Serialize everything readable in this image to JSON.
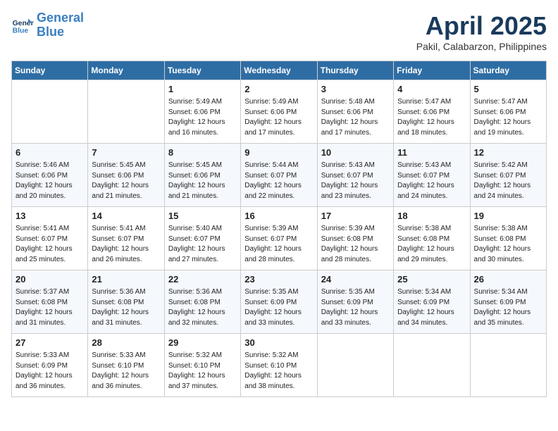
{
  "header": {
    "logo_line1": "General",
    "logo_line2": "Blue",
    "title": "April 2025",
    "location": "Pakil, Calabarzon, Philippines"
  },
  "weekdays": [
    "Sunday",
    "Monday",
    "Tuesday",
    "Wednesday",
    "Thursday",
    "Friday",
    "Saturday"
  ],
  "weeks": [
    [
      {
        "day": "",
        "sunrise": "",
        "sunset": "",
        "daylight": ""
      },
      {
        "day": "",
        "sunrise": "",
        "sunset": "",
        "daylight": ""
      },
      {
        "day": "1",
        "sunrise": "Sunrise: 5:49 AM",
        "sunset": "Sunset: 6:06 PM",
        "daylight": "Daylight: 12 hours and 16 minutes."
      },
      {
        "day": "2",
        "sunrise": "Sunrise: 5:49 AM",
        "sunset": "Sunset: 6:06 PM",
        "daylight": "Daylight: 12 hours and 17 minutes."
      },
      {
        "day": "3",
        "sunrise": "Sunrise: 5:48 AM",
        "sunset": "Sunset: 6:06 PM",
        "daylight": "Daylight: 12 hours and 17 minutes."
      },
      {
        "day": "4",
        "sunrise": "Sunrise: 5:47 AM",
        "sunset": "Sunset: 6:06 PM",
        "daylight": "Daylight: 12 hours and 18 minutes."
      },
      {
        "day": "5",
        "sunrise": "Sunrise: 5:47 AM",
        "sunset": "Sunset: 6:06 PM",
        "daylight": "Daylight: 12 hours and 19 minutes."
      }
    ],
    [
      {
        "day": "6",
        "sunrise": "Sunrise: 5:46 AM",
        "sunset": "Sunset: 6:06 PM",
        "daylight": "Daylight: 12 hours and 20 minutes."
      },
      {
        "day": "7",
        "sunrise": "Sunrise: 5:45 AM",
        "sunset": "Sunset: 6:06 PM",
        "daylight": "Daylight: 12 hours and 21 minutes."
      },
      {
        "day": "8",
        "sunrise": "Sunrise: 5:45 AM",
        "sunset": "Sunset: 6:06 PM",
        "daylight": "Daylight: 12 hours and 21 minutes."
      },
      {
        "day": "9",
        "sunrise": "Sunrise: 5:44 AM",
        "sunset": "Sunset: 6:07 PM",
        "daylight": "Daylight: 12 hours and 22 minutes."
      },
      {
        "day": "10",
        "sunrise": "Sunrise: 5:43 AM",
        "sunset": "Sunset: 6:07 PM",
        "daylight": "Daylight: 12 hours and 23 minutes."
      },
      {
        "day": "11",
        "sunrise": "Sunrise: 5:43 AM",
        "sunset": "Sunset: 6:07 PM",
        "daylight": "Daylight: 12 hours and 24 minutes."
      },
      {
        "day": "12",
        "sunrise": "Sunrise: 5:42 AM",
        "sunset": "Sunset: 6:07 PM",
        "daylight": "Daylight: 12 hours and 24 minutes."
      }
    ],
    [
      {
        "day": "13",
        "sunrise": "Sunrise: 5:41 AM",
        "sunset": "Sunset: 6:07 PM",
        "daylight": "Daylight: 12 hours and 25 minutes."
      },
      {
        "day": "14",
        "sunrise": "Sunrise: 5:41 AM",
        "sunset": "Sunset: 6:07 PM",
        "daylight": "Daylight: 12 hours and 26 minutes."
      },
      {
        "day": "15",
        "sunrise": "Sunrise: 5:40 AM",
        "sunset": "Sunset: 6:07 PM",
        "daylight": "Daylight: 12 hours and 27 minutes."
      },
      {
        "day": "16",
        "sunrise": "Sunrise: 5:39 AM",
        "sunset": "Sunset: 6:07 PM",
        "daylight": "Daylight: 12 hours and 28 minutes."
      },
      {
        "day": "17",
        "sunrise": "Sunrise: 5:39 AM",
        "sunset": "Sunset: 6:08 PM",
        "daylight": "Daylight: 12 hours and 28 minutes."
      },
      {
        "day": "18",
        "sunrise": "Sunrise: 5:38 AM",
        "sunset": "Sunset: 6:08 PM",
        "daylight": "Daylight: 12 hours and 29 minutes."
      },
      {
        "day": "19",
        "sunrise": "Sunrise: 5:38 AM",
        "sunset": "Sunset: 6:08 PM",
        "daylight": "Daylight: 12 hours and 30 minutes."
      }
    ],
    [
      {
        "day": "20",
        "sunrise": "Sunrise: 5:37 AM",
        "sunset": "Sunset: 6:08 PM",
        "daylight": "Daylight: 12 hours and 31 minutes."
      },
      {
        "day": "21",
        "sunrise": "Sunrise: 5:36 AM",
        "sunset": "Sunset: 6:08 PM",
        "daylight": "Daylight: 12 hours and 31 minutes."
      },
      {
        "day": "22",
        "sunrise": "Sunrise: 5:36 AM",
        "sunset": "Sunset: 6:08 PM",
        "daylight": "Daylight: 12 hours and 32 minutes."
      },
      {
        "day": "23",
        "sunrise": "Sunrise: 5:35 AM",
        "sunset": "Sunset: 6:09 PM",
        "daylight": "Daylight: 12 hours and 33 minutes."
      },
      {
        "day": "24",
        "sunrise": "Sunrise: 5:35 AM",
        "sunset": "Sunset: 6:09 PM",
        "daylight": "Daylight: 12 hours and 33 minutes."
      },
      {
        "day": "25",
        "sunrise": "Sunrise: 5:34 AM",
        "sunset": "Sunset: 6:09 PM",
        "daylight": "Daylight: 12 hours and 34 minutes."
      },
      {
        "day": "26",
        "sunrise": "Sunrise: 5:34 AM",
        "sunset": "Sunset: 6:09 PM",
        "daylight": "Daylight: 12 hours and 35 minutes."
      }
    ],
    [
      {
        "day": "27",
        "sunrise": "Sunrise: 5:33 AM",
        "sunset": "Sunset: 6:09 PM",
        "daylight": "Daylight: 12 hours and 36 minutes."
      },
      {
        "day": "28",
        "sunrise": "Sunrise: 5:33 AM",
        "sunset": "Sunset: 6:10 PM",
        "daylight": "Daylight: 12 hours and 36 minutes."
      },
      {
        "day": "29",
        "sunrise": "Sunrise: 5:32 AM",
        "sunset": "Sunset: 6:10 PM",
        "daylight": "Daylight: 12 hours and 37 minutes."
      },
      {
        "day": "30",
        "sunrise": "Sunrise: 5:32 AM",
        "sunset": "Sunset: 6:10 PM",
        "daylight": "Daylight: 12 hours and 38 minutes."
      },
      {
        "day": "",
        "sunrise": "",
        "sunset": "",
        "daylight": ""
      },
      {
        "day": "",
        "sunrise": "",
        "sunset": "",
        "daylight": ""
      },
      {
        "day": "",
        "sunrise": "",
        "sunset": "",
        "daylight": ""
      }
    ]
  ]
}
